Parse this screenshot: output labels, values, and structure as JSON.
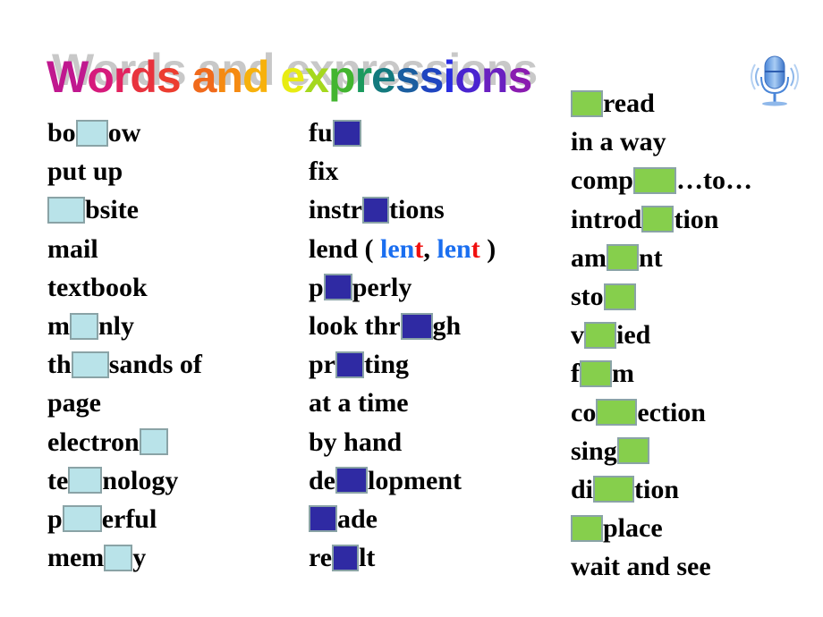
{
  "title": {
    "text": "Words and expressions",
    "letters": [
      {
        "ch": "W",
        "color": "#c0188f"
      },
      {
        "ch": "o",
        "color": "#d61a7c"
      },
      {
        "ch": "r",
        "color": "#e2235f"
      },
      {
        "ch": "d",
        "color": "#e8333e"
      },
      {
        "ch": "s",
        "color": "#ec3d30"
      },
      {
        "ch": " ",
        "color": "#000000"
      },
      {
        "ch": "a",
        "color": "#f06a1c"
      },
      {
        "ch": "n",
        "color": "#f58a12"
      },
      {
        "ch": "d",
        "color": "#f7b10c"
      },
      {
        "ch": " ",
        "color": "#000000"
      },
      {
        "ch": "e",
        "color": "#e8ec12"
      },
      {
        "ch": "x",
        "color": "#a5d81e"
      },
      {
        "ch": "p",
        "color": "#43b530"
      },
      {
        "ch": "r",
        "color": "#1b9a5e"
      },
      {
        "ch": "e",
        "color": "#137a7e"
      },
      {
        "ch": "s",
        "color": "#1b5ea0"
      },
      {
        "ch": "s",
        "color": "#1f45c0"
      },
      {
        "ch": "i",
        "color": "#2a2ee0"
      },
      {
        "ch": "o",
        "color": "#4a24d0"
      },
      {
        "ch": "n",
        "color": "#6a20c0"
      },
      {
        "ch": "s",
        "color": "#8a1cb0"
      }
    ]
  },
  "icon": "microphone-icon",
  "colors": {
    "column1_box": "#b9e3e9",
    "column2_box": "#2f2aa3",
    "column3_box": "#86cf4c",
    "box_border": "#8aa3a6",
    "blue_text": "#1a6ef0",
    "red_text": "#f01010"
  },
  "columns": [
    {
      "box_style": "c1",
      "items": [
        [
          {
            "t": "bo"
          },
          {
            "box": 36
          },
          {
            "t": "ow"
          }
        ],
        [
          {
            "t": "put up"
          }
        ],
        [
          {
            "box": 42
          },
          {
            "t": "bsite"
          }
        ],
        [
          {
            "t": "mail"
          }
        ],
        [
          {
            "t": "textbook"
          }
        ],
        [
          {
            "t": "m"
          },
          {
            "box": 32
          },
          {
            "t": "nly"
          }
        ],
        [
          {
            "t": "th"
          },
          {
            "box": 42
          },
          {
            "t": "sands of"
          }
        ],
        [
          {
            "t": "page"
          }
        ],
        [
          {
            "t": "electron"
          },
          {
            "box": 32
          }
        ],
        [
          {
            "t": "te"
          },
          {
            "box": 38
          },
          {
            "t": "nology"
          }
        ],
        [
          {
            "t": "p"
          },
          {
            "box": 44
          },
          {
            "t": "erful"
          }
        ],
        [
          {
            "t": "mem"
          },
          {
            "box": 32
          },
          {
            "t": "y"
          }
        ]
      ]
    },
    {
      "box_style": "c2",
      "items": [
        [
          {
            "t": "fu"
          },
          {
            "box": 32
          }
        ],
        [
          {
            "t": "fix"
          }
        ],
        [
          {
            "t": "instr"
          },
          {
            "box": 30
          },
          {
            "t": "tions"
          }
        ],
        [
          {
            "t": "lend ( "
          },
          {
            "t": "len",
            "cls": "blue"
          },
          {
            "t": "t",
            "cls": "red"
          },
          {
            "t": ", "
          },
          {
            "t": "len",
            "cls": "blue"
          },
          {
            "t": "t",
            "cls": "red"
          },
          {
            "t": " )"
          }
        ],
        [
          {
            "t": "p"
          },
          {
            "box": 32
          },
          {
            "t": "perly"
          }
        ],
        [
          {
            "t": "look thr"
          },
          {
            "box": 36
          },
          {
            "t": "gh"
          }
        ],
        [
          {
            "t": "pr"
          },
          {
            "box": 32
          },
          {
            "t": "ting"
          }
        ],
        [
          {
            "t": "at a time"
          }
        ],
        [
          {
            "t": "by hand"
          }
        ],
        [
          {
            "t": "de"
          },
          {
            "box": 36
          },
          {
            "t": "lopment"
          }
        ],
        [
          {
            "box": 32
          },
          {
            "t": "ade"
          }
        ],
        [
          {
            "t": "re"
          },
          {
            "box": 30
          },
          {
            "t": "lt"
          }
        ]
      ]
    },
    {
      "box_style": "c3",
      "items": [
        [
          {
            "box": 36
          },
          {
            "t": "read"
          }
        ],
        [
          {
            "t": "in a way"
          }
        ],
        [
          {
            "t": "comp"
          },
          {
            "box": 48
          },
          {
            "t": "…to…"
          }
        ],
        [
          {
            "t": "introd"
          },
          {
            "box": 36
          },
          {
            "t": "tion"
          }
        ],
        [
          {
            "t": "am"
          },
          {
            "box": 36
          },
          {
            "t": "nt"
          }
        ],
        [
          {
            "t": "sto"
          },
          {
            "box": 36
          }
        ],
        [
          {
            "t": "v"
          },
          {
            "box": 36
          },
          {
            "t": "ied"
          }
        ],
        [
          {
            "t": "f"
          },
          {
            "box": 36
          },
          {
            "t": "m"
          }
        ],
        [
          {
            "t": "co"
          },
          {
            "box": 46
          },
          {
            "t": "ection"
          }
        ],
        [
          {
            "t": "sing"
          },
          {
            "box": 36
          }
        ],
        [
          {
            "t": "di"
          },
          {
            "box": 46
          },
          {
            "t": "tion"
          }
        ],
        [
          {
            "box": 36
          },
          {
            "t": "place"
          }
        ],
        [
          {
            "t": "wait and see"
          }
        ]
      ]
    }
  ]
}
